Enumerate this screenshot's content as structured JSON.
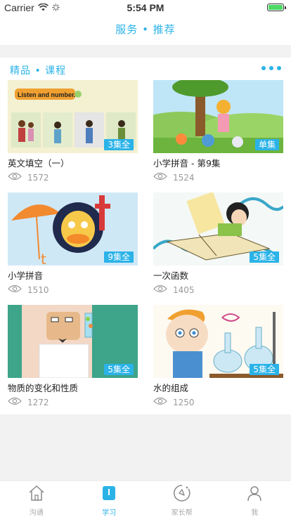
{
  "status_bar": {
    "carrier": "Carrier",
    "time": "5:54 PM"
  },
  "nav": {
    "title": "服务 • 推荐"
  },
  "section": {
    "title": "精品 • 课程"
  },
  "courses": [
    {
      "title": "英文填空（一）",
      "badge": "3集全",
      "views": "1572",
      "thumb_text": "Listen and number."
    },
    {
      "title": "小学拼音 - 第9集",
      "badge": "单集",
      "views": "1524"
    },
    {
      "title": "小学拼音",
      "badge": "9集全",
      "views": "1510",
      "thumb_text": "t"
    },
    {
      "title": "一次函数",
      "badge": "5集全",
      "views": "1405"
    },
    {
      "title": "物质的变化和性质",
      "badge": "5集全",
      "views": "1272"
    },
    {
      "title": "水的组成",
      "badge": "5集全",
      "views": "1250"
    }
  ],
  "tabs": [
    {
      "label": "沟通",
      "icon": "home-icon"
    },
    {
      "label": "学习",
      "icon": "book-icon",
      "active": true
    },
    {
      "label": "家长帮",
      "icon": "compass-icon"
    },
    {
      "label": "我",
      "icon": "person-icon"
    }
  ],
  "colors": {
    "accent": "#2bb3e8",
    "battery": "#4cd964"
  }
}
